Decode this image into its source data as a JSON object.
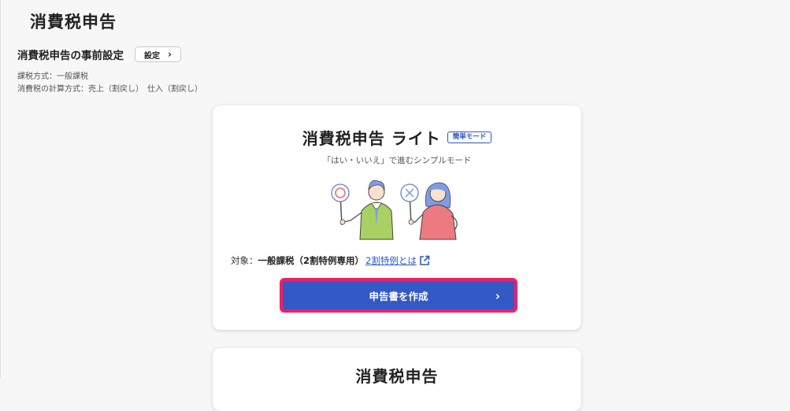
{
  "page": {
    "title": "消費税申告",
    "pre_settings_label": "消費税申告の事前設定",
    "settings_button": "設定",
    "tax_method": "課税方式：一般課税",
    "calc_method": "消費税の計算方式：売上（割戻し）　仕入（割戻し）"
  },
  "lite_card": {
    "title": "消費税申告 ライト",
    "badge": "簡単モード",
    "subtitle": "「はい・いいえ」で進むシンプルモード",
    "target_prefix": "対象：",
    "target_value": "一般課税（2割特例専用）",
    "target_link": "2割特例とは",
    "create_button": "申告書を作成"
  },
  "second_card": {
    "title": "消費税申告"
  },
  "colors": {
    "accent": "#3359c6",
    "highlight_border": "#ef1f66",
    "link": "#2a5bd0"
  }
}
